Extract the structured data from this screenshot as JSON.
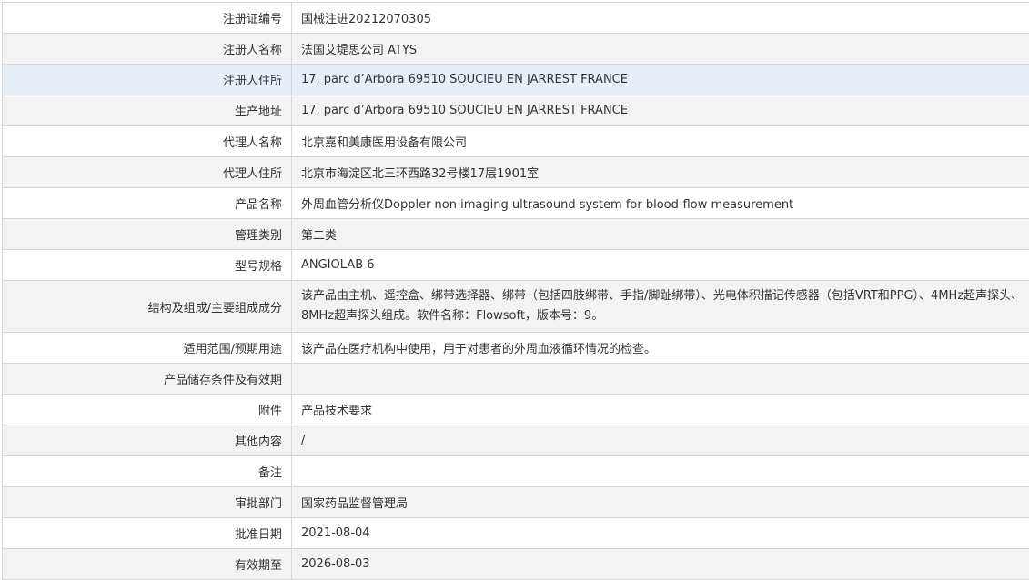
{
  "rows": [
    {
      "label": "注册证编号",
      "value": "国械注进20212070305"
    },
    {
      "label": "注册人名称",
      "value": "法国艾堤思公司 ATYS"
    },
    {
      "label": "注册人住所",
      "value": "17, parc d’Arbora 69510 SOUCIEU EN JARREST FRANCE"
    },
    {
      "label": "生产地址",
      "value": "17, parc d’Arbora 69510 SOUCIEU EN JARREST FRANCE"
    },
    {
      "label": "代理人名称",
      "value": "北京嘉和美康医用设备有限公司"
    },
    {
      "label": "代理人住所",
      "value": "北京市海淀区北三环西路32号楼17层1901室"
    },
    {
      "label": "产品名称",
      "value": "外周血管分析仪Doppler non imaging ultrasound system for blood-flow measurement"
    },
    {
      "label": "管理类别",
      "value": "第二类"
    },
    {
      "label": "型号规格",
      "value": "ANGIOLAB 6"
    },
    {
      "label": "结构及组成/主要组成成分",
      "value": "该产品由主机、遥控盒、绑带选择器、绑带（包括四肢绑带、手指/脚趾绑带）、光电体积描记传感器（包括VRT和PPG）、4MHz超声探头、8MHz超声探头组成。软件名称：Flowsoft，版本号：9。"
    },
    {
      "label": "适用范围/预期用途",
      "value": "该产品在医疗机构中使用，用于对患者的外周血液循环情况的检查。"
    },
    {
      "label": "产品储存条件及有效期",
      "value": ""
    },
    {
      "label": "附件",
      "value": "产品技术要求"
    },
    {
      "label": "其他内容",
      "value": "/"
    },
    {
      "label": "备注",
      "value": ""
    },
    {
      "label": "审批部门",
      "value": "国家药品监督管理局"
    },
    {
      "label": "批准日期",
      "value": "2021-08-04"
    },
    {
      "label": "有效期至",
      "value": "2026-08-03"
    }
  ]
}
